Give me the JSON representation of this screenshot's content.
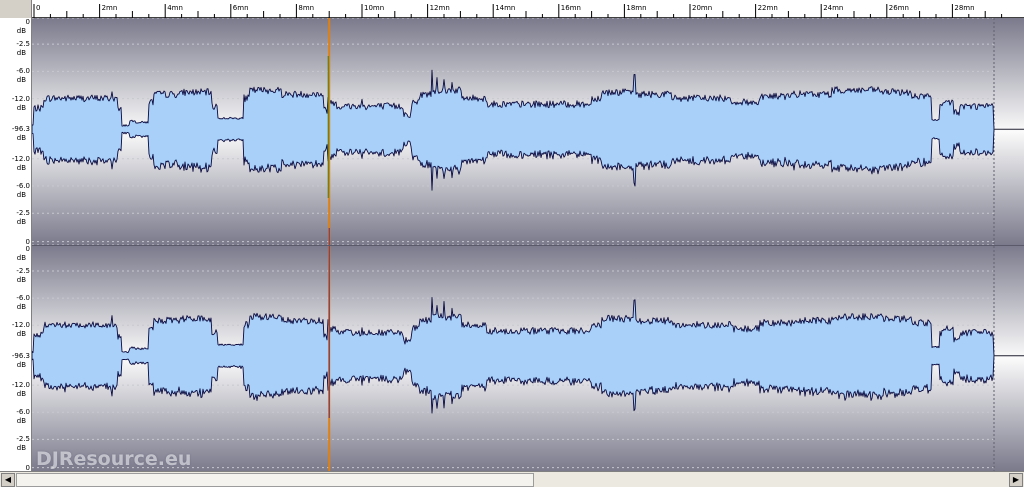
{
  "timeline": {
    "ticks": [
      "0",
      "2mn",
      "4mn",
      "6mn",
      "8mn",
      "10mn",
      "12mn",
      "14mn",
      "16mn",
      "18mn",
      "20mn",
      "22mn",
      "24mn",
      "26mn",
      "28mn"
    ]
  },
  "db_scale": {
    "labels": [
      "0",
      "-2.5",
      "-6.0",
      "-12.0",
      "-96.3",
      "-12.0",
      "-6.0",
      "-2.5",
      "0"
    ],
    "unit": "dB"
  },
  "playhead": {
    "position_mn": 9.0
  },
  "colors": {
    "waveform_fill": "#a8d0f8",
    "waveform_outline": "#0a0a40",
    "playhead": "#e08010",
    "bg_edge": "#787888",
    "bg_center": "#fafafa"
  },
  "scrollbar": {
    "left_icon": "arrow-left-icon",
    "right_icon": "arrow-right-icon"
  },
  "watermark": {
    "text": "DJResource.eu"
  }
}
